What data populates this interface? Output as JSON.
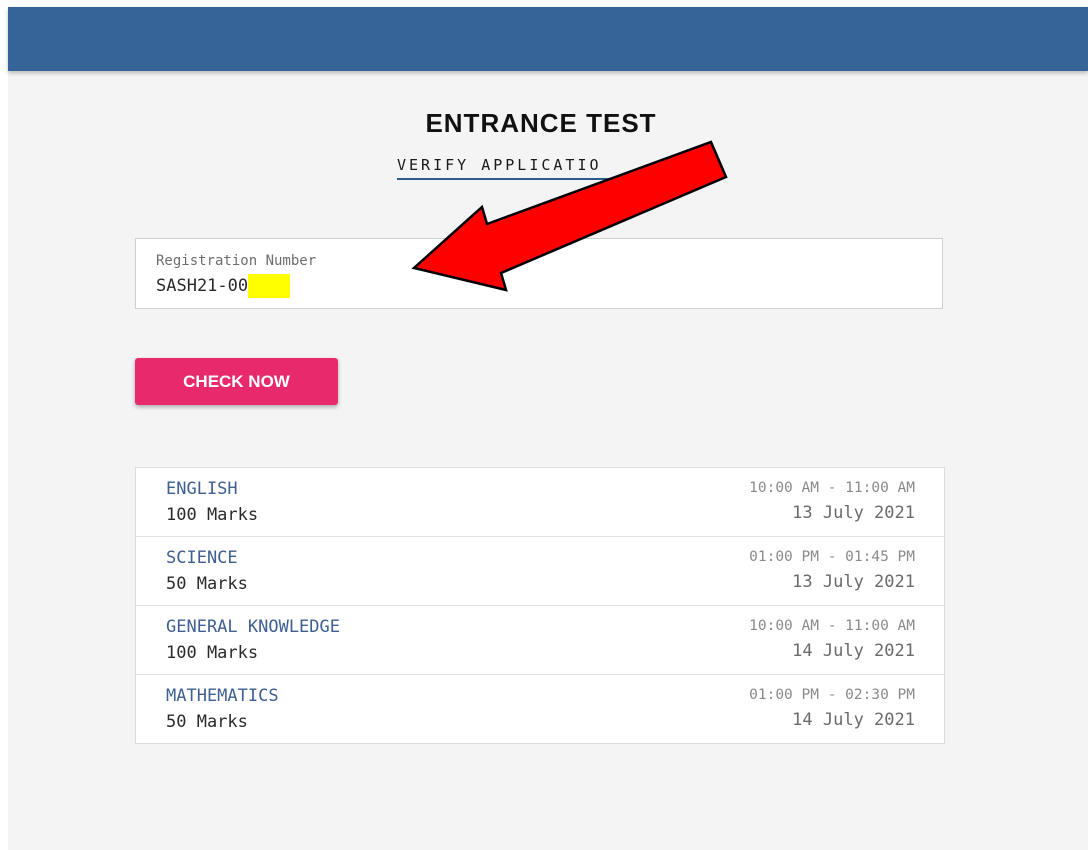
{
  "page": {
    "title": "ENTRANCE TEST",
    "subtitle": "VERIFY APPLICATIO"
  },
  "registration": {
    "label": "Registration Number",
    "value": "SASH21-00"
  },
  "actions": {
    "check_label": "CHECK NOW"
  },
  "schedule": [
    {
      "subject": "ENGLISH",
      "marks": "100 Marks",
      "time": "10:00 AM - 11:00 AM",
      "date": "13 July 2021"
    },
    {
      "subject": "SCIENCE",
      "marks": "50 Marks",
      "time": "01:00 PM - 01:45 PM",
      "date": "13 July 2021"
    },
    {
      "subject": "GENERAL KNOWLEDGE",
      "marks": "100 Marks",
      "time": "10:00 AM - 11:00 AM",
      "date": "14 July 2021"
    },
    {
      "subject": "MATHEMATICS",
      "marks": "50 Marks",
      "time": "01:00 PM - 02:30 PM",
      "date": "14 July 2021"
    }
  ],
  "colors": {
    "header": "#366498",
    "button": "#e8296b",
    "subject_text": "#3d5f91",
    "redaction": "#ffff00",
    "annotation_arrow": "#ff0000"
  },
  "icons": {
    "annotation": "red-arrow-annotation-icon"
  }
}
